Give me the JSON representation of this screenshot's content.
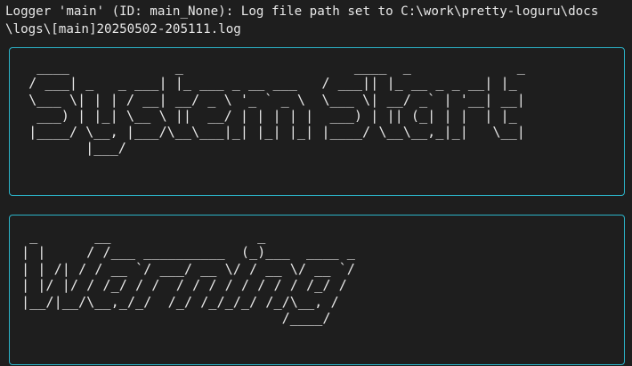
{
  "log": {
    "line1": "Logger 'main' (ID: main_None): Log file path set to C:\\work\\pretty-loguru\\docs",
    "line2": "\\logs\\[main]20250502-205111.log"
  },
  "banner_system_start": {
    "ascii": "  ____             _                     ____  _             _   \n / ___| _   _ ___| |_ ___ _ __ ___   / ___|| |_ __ _ _ __| |_ \n \\___ \\| | | / __| __/ _ \\ '_ ` _ \\  \\___ \\| __/ _` | '__| __|\n  ___) | |_| \\__ \\ ||  __/ | | | | |  ___) | || (_| | |  | |_ \n |____/ \\__, |___/\\__\\___|_| |_| |_| |____/ \\__\\__,_|_|   \\__|\n        |___/                                                  "
  },
  "banner_warning": {
    "ascii": " _       __                  _             \n| |     / /___ __________  (_)___  ____ _\n| | /| / / __ `/ ___/ __ \\/ / __ \\/ __ `/\n| |/ |/ / /_/ / /  / / / / / / / / /_/ / \n|__/|__/\\__,_/_/  /_/ /_/_/_/ /_/\\__, /  \n                                /____/   "
  }
}
